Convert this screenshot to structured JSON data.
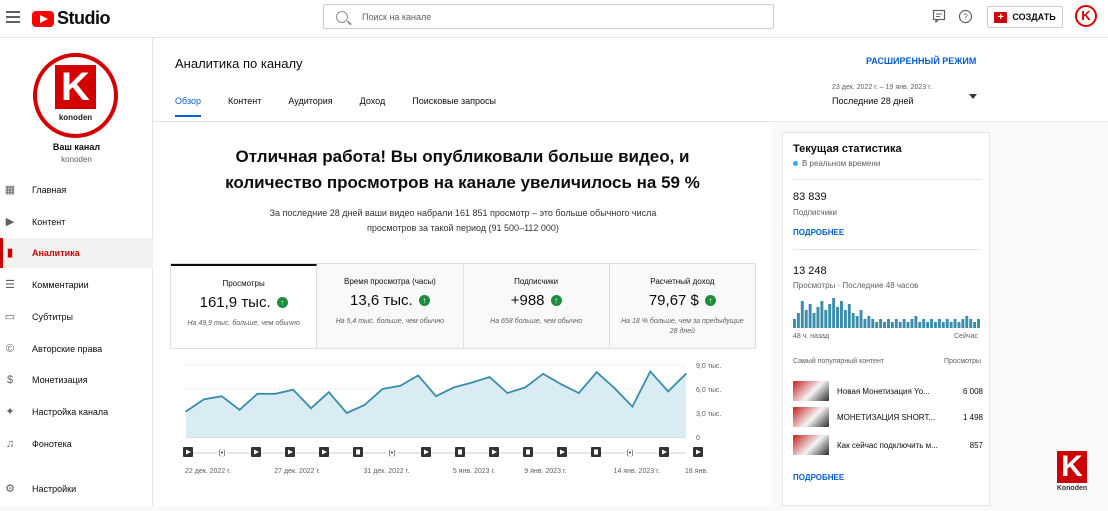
{
  "app": {
    "logo_text": "Studio"
  },
  "search": {
    "placeholder": "Поиск на канале"
  },
  "toolbar": {
    "create_label": "СОЗДАТЬ",
    "avatar_letter": "K"
  },
  "sidebar": {
    "channel_logo_letter": "K",
    "channel_logo_name": "konoden",
    "channel_title": "Ваш канал",
    "channel_handle": "konoden",
    "items": [
      {
        "label": "Главная",
        "icon": "dashboard-icon"
      },
      {
        "label": "Контент",
        "icon": "content-icon"
      },
      {
        "label": "Аналитика",
        "icon": "analytics-icon",
        "active": true
      },
      {
        "label": "Комментарии",
        "icon": "comments-icon"
      },
      {
        "label": "Субтитры",
        "icon": "subtitles-icon"
      },
      {
        "label": "Авторские права",
        "icon": "copyright-icon"
      },
      {
        "label": "Монетизация",
        "icon": "dollar-icon"
      },
      {
        "label": "Настройка канала",
        "icon": "customization-icon"
      },
      {
        "label": "Фонотека",
        "icon": "audio-library-icon"
      },
      {
        "label": "Настройки",
        "icon": "gear-icon"
      }
    ]
  },
  "header": {
    "title": "Аналитика по каналу",
    "advanced_mode": "РАСШИРЕННЫЙ РЕЖИМ",
    "tabs": [
      "Обзор",
      "Контент",
      "Аудитория",
      "Доход",
      "Поисковые запросы"
    ],
    "date_range": "23 дек. 2022 г. – 19 янв. 2023 г.",
    "date_label": "Последние 28 дней"
  },
  "main": {
    "headline_1": "Отличная работа! Вы опубликовали больше видео, и",
    "headline_2": "количество просмотров на канале увеличилось на 59 %",
    "sub_1": "За последние 28 дней ваши видео набрали 161 851 просмотр – это больше обычного числа",
    "sub_2": "просмотров за такой период (91 500–112 000)",
    "cards": [
      {
        "label": "Просмотры",
        "value": "161,9 тыс.",
        "note": "На 49,9 тыс. больше, чем обычно"
      },
      {
        "label": "Время просмотра (часы)",
        "value": "13,6 тыс.",
        "note": "На 5,4 тыс. больше, чем обычно"
      },
      {
        "label": "Подписчики",
        "value": "+988",
        "note": "На 658 больше, чем обычно"
      },
      {
        "label": "Расчетный доход",
        "value": "79,67 $",
        "note": "На 18 % больше, чем за предыдущие 28 дней"
      }
    ]
  },
  "chart_data": {
    "type": "area",
    "x": [
      "22 дек. 2022 г.",
      "",
      "",
      "",
      "",
      "27 дек. 2022 г.",
      "",
      "",
      "",
      "",
      "31 дек. 2022 г.",
      "",
      "",
      "",
      "",
      "5 янв. 2023 г.",
      "",
      "",
      "",
      "9 янв. 2023 г.",
      "",
      "",
      "",
      "",
      "14 янв. 2023 г.",
      "",
      "",
      "",
      "18 янв."
    ],
    "values": [
      3.2,
      4.7,
      5.1,
      3.4,
      5.4,
      5.4,
      5.9,
      3.6,
      5.6,
      3.0,
      4.0,
      6.0,
      6.4,
      7.7,
      5.1,
      6.2,
      6.8,
      7.5,
      5.5,
      6.2,
      7.9,
      6.6,
      5.5,
      8.1,
      6.1,
      3.8,
      8.2,
      5.7,
      7.9
    ],
    "x_tick_labels": [
      "22 дек. 2022 г.",
      "27 дек. 2022 г.",
      "31 дек. 2022 г.",
      "5 янв. 2023 г.",
      "9 янв. 2023 г.",
      "14 янв. 2023 г.",
      "18 янв."
    ],
    "y_ticks": [
      "9,0 тыс.",
      "6,0 тыс.",
      "3,0 тыс.",
      "0"
    ],
    "ylim": [
      0,
      9
    ],
    "color": "#3a8dab",
    "markers": [
      "play",
      "live",
      "play",
      "play",
      "play",
      "short",
      "live",
      "play",
      "short",
      "play",
      "short",
      "play",
      "short",
      "live",
      "play",
      "play"
    ]
  },
  "right_panel": {
    "title": "Текущая статистика",
    "live_label": "В реальном времени",
    "subs_value": "83 839",
    "subs_label": "Подписчики",
    "more_1": "ПОДРОБНЕЕ",
    "views_value": "13 248",
    "views_label": "Просмотры · Последние 48 часов",
    "axis_left": "48 ч. назад",
    "axis_right": "Сейчас",
    "bar_values": [
      3,
      5,
      9,
      6,
      8,
      5,
      7,
      9,
      6,
      8,
      10,
      7,
      9,
      6,
      8,
      5,
      4,
      6,
      3,
      4,
      3,
      2,
      3,
      2,
      3,
      2,
      3,
      2,
      3,
      2,
      3,
      4,
      2,
      3,
      2,
      3,
      2,
      3,
      2,
      3,
      2,
      3,
      2,
      3,
      4,
      3,
      2,
      3
    ],
    "pop_head_left": "Самый популярный контент",
    "pop_head_right": "Просмотры",
    "popular": [
      {
        "title": "Новая Монетизация Yo...",
        "views": "6 008"
      },
      {
        "title": "МОНЕТИЗАЦИЯ SHORT...",
        "views": "1 498"
      },
      {
        "title": "Как сейчас подключить м...",
        "views": "857"
      }
    ],
    "more_2": "ПОДРОБНЕЕ"
  },
  "watermark": {
    "letter": "K",
    "text": "Konoden"
  }
}
